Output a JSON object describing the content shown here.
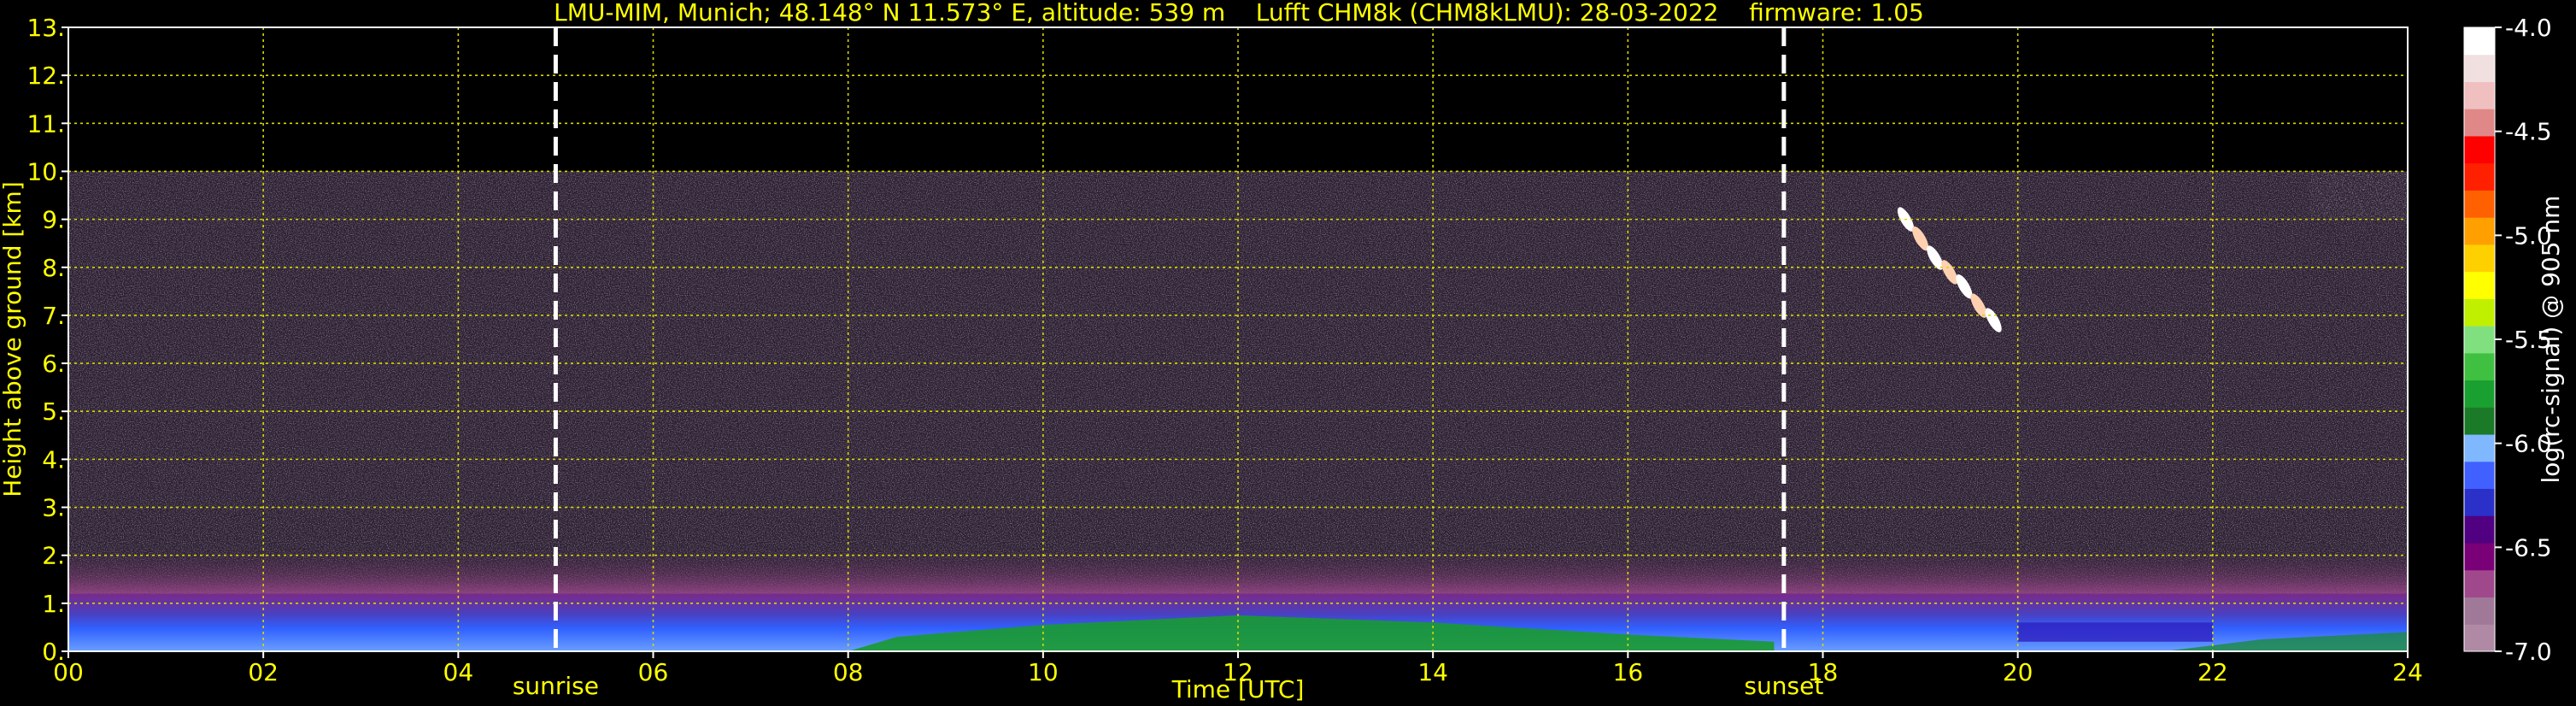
{
  "chart_data": {
    "type": "heatmap",
    "title": "LMU-MIM, Munich; 48.148° N 11.573° E, altitude: 539 m    Lufft CHM8k (CHM8kLMU): 28-03-2022    firmware: 1.05",
    "xlabel": "Time [UTC]",
    "ylabel": "Height above ground [km]",
    "xlim": [
      0,
      24
    ],
    "ylim": [
      0,
      13
    ],
    "x_ticks": [
      "00",
      "02",
      "04",
      "06",
      "08",
      "10",
      "12",
      "14",
      "16",
      "18",
      "20",
      "22",
      "24"
    ],
    "y_ticks": [
      "0.",
      "1.",
      "2.",
      "3.",
      "4.",
      "5.",
      "6.",
      "7.",
      "8.",
      "9.",
      "10.",
      "11.",
      "12.",
      "13."
    ],
    "grid": true,
    "data_top_km": 10.0,
    "events": [
      {
        "label": "sunrise",
        "time_h": 5.0
      },
      {
        "label": "sunset",
        "time_h": 17.6
      }
    ],
    "colorbar": {
      "label": "log(rc-signal) @ 905 nm",
      "range": [
        -7.0,
        -4.0
      ],
      "ticks": [
        "-4.0",
        "-4.5",
        "-5.0",
        "-5.5",
        "-6.0",
        "-6.5",
        "-7.0"
      ],
      "colors": [
        "#b08aa4",
        "#a07898",
        "#a0488c",
        "#7a0078",
        "#500080",
        "#2a30c8",
        "#4060ff",
        "#80b8ff",
        "#1a7a28",
        "#1aa030",
        "#40c040",
        "#80e080",
        "#c0f000",
        "#ffff00",
        "#ffd000",
        "#ffa000",
        "#ff6000",
        "#ff2000",
        "#ff0000",
        "#e08888",
        "#f0c0c0",
        "#f0e0e0",
        "#ffffff"
      ]
    },
    "features": [
      {
        "name": "aerosol boundary layer",
        "t": [
          0,
          24
        ],
        "z_km": [
          0,
          1.2
        ]
      },
      {
        "name": "residual layer",
        "t": [
          0,
          24
        ],
        "z_km": [
          1.2,
          2.2
        ]
      },
      {
        "name": "cirrus streaks",
        "t": [
          18.8,
          19.8
        ],
        "z_km": [
          6.8,
          9.1
        ]
      },
      {
        "name": "upper cloud",
        "t": [
          23.0,
          24.0
        ],
        "z_km": [
          9.0,
          10.0
        ]
      }
    ]
  }
}
